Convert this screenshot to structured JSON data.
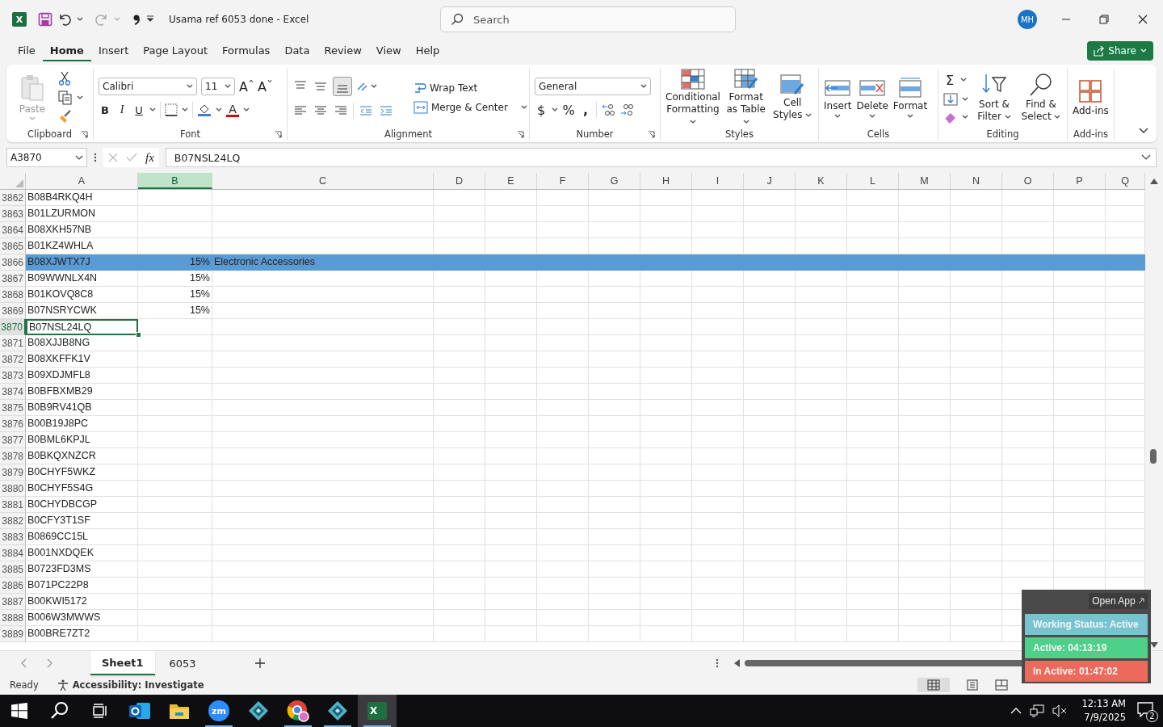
{
  "title_bar": {
    "app_letter": "X",
    "document_title": "Usama ref 6053 done  -  Excel",
    "search_placeholder": "Search",
    "avatar_initials": "MH"
  },
  "menu_tabs": [
    {
      "label": "File",
      "selected": false
    },
    {
      "label": "Home",
      "selected": true
    },
    {
      "label": "Insert",
      "selected": false
    },
    {
      "label": "Page Layout",
      "selected": false
    },
    {
      "label": "Formulas",
      "selected": false
    },
    {
      "label": "Data",
      "selected": false
    },
    {
      "label": "Review",
      "selected": false
    },
    {
      "label": "View",
      "selected": false
    },
    {
      "label": "Help",
      "selected": false
    }
  ],
  "share_button": "Share",
  "ribbon": {
    "clipboard": {
      "paste": "Paste",
      "label": "Clipboard"
    },
    "font": {
      "name": "Calibri",
      "size": "11",
      "grow": "A",
      "shrink": "A",
      "bold": "B",
      "italic": "I",
      "underline": "U",
      "color_letter": "A",
      "label": "Font"
    },
    "alignment": {
      "wrap_text": "Wrap Text",
      "merge": "Merge & Center",
      "label": "Alignment"
    },
    "number": {
      "format": "General",
      "currency": "$",
      "percent": "%",
      "comma": ",",
      "label": "Number"
    },
    "styles": {
      "buttons": [
        "Conditional Formatting",
        "Format as Table",
        "Cell Styles"
      ],
      "label": "Styles"
    },
    "cells": {
      "buttons": [
        "Insert",
        "Delete",
        "Format"
      ],
      "label": "Cells"
    },
    "editing": {
      "sum": "Σ",
      "buttons": [
        "Sort & Filter",
        "Find & Select"
      ],
      "label": "Editing"
    },
    "addins": {
      "button": "Add-ins",
      "label": "Add-ins"
    }
  },
  "formula_bar": {
    "name_box": "A3870",
    "fx": "fx",
    "formula": "B07NSL24LQ"
  },
  "columns": [
    {
      "label": "A",
      "selected": false
    },
    {
      "label": "B",
      "selected": true
    },
    {
      "label": "C",
      "selected": false
    },
    {
      "label": "D",
      "selected": false
    },
    {
      "label": "E",
      "selected": false
    },
    {
      "label": "F",
      "selected": false
    },
    {
      "label": "G",
      "selected": false
    },
    {
      "label": "H",
      "selected": false
    },
    {
      "label": "I",
      "selected": false
    },
    {
      "label": "J",
      "selected": false
    },
    {
      "label": "K",
      "selected": false
    },
    {
      "label": "L",
      "selected": false
    },
    {
      "label": "M",
      "selected": false
    },
    {
      "label": "N",
      "selected": false
    },
    {
      "label": "O",
      "selected": false
    },
    {
      "label": "P",
      "selected": false
    },
    {
      "label": "Q",
      "selected": false
    }
  ],
  "rows": [
    {
      "number": "3862",
      "cells": [
        "B08B4RKQ4H"
      ],
      "highlighted": false,
      "active": false
    },
    {
      "number": "3863",
      "cells": [
        "B01LZURMON"
      ],
      "highlighted": false,
      "active": false
    },
    {
      "number": "3864",
      "cells": [
        "B08XKH57NB"
      ],
      "highlighted": false,
      "active": false
    },
    {
      "number": "3865",
      "cells": [
        "B01KZ4WHLA"
      ],
      "highlighted": false,
      "active": false
    },
    {
      "number": "3866",
      "cells": [
        "B08XJWTX7J",
        "15%",
        "Electronic Accessories"
      ],
      "highlighted": true,
      "active": false
    },
    {
      "number": "3867",
      "cells": [
        "B09WWNLX4N",
        "15%"
      ],
      "highlighted": false,
      "active": false
    },
    {
      "number": "3868",
      "cells": [
        "B01KOVQ8C8",
        "15%"
      ],
      "highlighted": false,
      "active": false
    },
    {
      "number": "3869",
      "cells": [
        "B07NSRYCWK",
        "15%"
      ],
      "highlighted": false,
      "active": false
    },
    {
      "number": "3870",
      "cells": [
        "B07NSL24LQ"
      ],
      "highlighted": false,
      "active": true
    },
    {
      "number": "3871",
      "cells": [
        "B08XJJB8NG"
      ],
      "highlighted": false,
      "active": false
    },
    {
      "number": "3872",
      "cells": [
        "B08XKFFK1V"
      ],
      "highlighted": false,
      "active": false
    },
    {
      "number": "3873",
      "cells": [
        "B09XDJMFL8"
      ],
      "highlighted": false,
      "active": false
    },
    {
      "number": "3874",
      "cells": [
        "B0BFBXMB29"
      ],
      "highlighted": false,
      "active": false
    },
    {
      "number": "3875",
      "cells": [
        "B0B9RV41QB"
      ],
      "highlighted": false,
      "active": false
    },
    {
      "number": "3876",
      "cells": [
        "B00B19J8PC"
      ],
      "highlighted": false,
      "active": false
    },
    {
      "number": "3877",
      "cells": [
        "B0BML6KPJL"
      ],
      "highlighted": false,
      "active": false
    },
    {
      "number": "3878",
      "cells": [
        "B0BKQXNZCR"
      ],
      "highlighted": false,
      "active": false
    },
    {
      "number": "3879",
      "cells": [
        "B0CHYF5WKZ"
      ],
      "highlighted": false,
      "active": false
    },
    {
      "number": "3880",
      "cells": [
        "B0CHYF5S4G"
      ],
      "highlighted": false,
      "active": false
    },
    {
      "number": "3881",
      "cells": [
        "B0CHYDBCGP"
      ],
      "highlighted": false,
      "active": false
    },
    {
      "number": "3882",
      "cells": [
        "B0CFY3T1SF"
      ],
      "highlighted": false,
      "active": false
    },
    {
      "number": "3883",
      "cells": [
        "B0869CC15L"
      ],
      "highlighted": false,
      "active": false
    },
    {
      "number": "3884",
      "cells": [
        "B001NXDQEK"
      ],
      "highlighted": false,
      "active": false
    },
    {
      "number": "3885",
      "cells": [
        "B0723FD3MS"
      ],
      "highlighted": false,
      "active": false
    },
    {
      "number": "3886",
      "cells": [
        "B071PC22P8"
      ],
      "highlighted": false,
      "active": false
    },
    {
      "number": "3887",
      "cells": [
        "B00KWI5172"
      ],
      "highlighted": false,
      "active": false
    },
    {
      "number": "3888",
      "cells": [
        "B006W3MWWS"
      ],
      "highlighted": false,
      "active": false
    },
    {
      "number": "3889",
      "cells": [
        "B00BRE7ZT2"
      ],
      "highlighted": false,
      "active": false
    }
  ],
  "sheet_tabs": [
    {
      "label": "Sheet1",
      "selected": true
    },
    {
      "label": "6053",
      "selected": false
    }
  ],
  "status_bar": {
    "ready": "Ready",
    "accessibility": "Accessibility: Investigate"
  },
  "tracker": {
    "open_app": "Open App",
    "statuses": [
      {
        "text": "Working Status: Active",
        "color": "#77c4d0"
      },
      {
        "text": "Active: 04:13:19",
        "color": "#4fd08a"
      },
      {
        "text": "In Active: 01:47:02",
        "color": "#ec6a5c"
      }
    ]
  },
  "taskbar": {
    "apps": [
      {
        "kind": "mail",
        "running": false,
        "selected": false
      },
      {
        "kind": "folder",
        "running": false,
        "selected": false
      },
      {
        "kind": "meeting",
        "label": "zm",
        "running": true,
        "selected": false
      },
      {
        "kind": "diamond",
        "running": false,
        "selected": false
      },
      {
        "kind": "browser",
        "running": true,
        "selected": false
      },
      {
        "kind": "diamond",
        "running": true,
        "selected": false
      },
      {
        "kind": "sheet",
        "label": "X",
        "running": true,
        "selected": true
      }
    ],
    "time": "12:13 AM",
    "date": "7/9/2025",
    "notifications": "2"
  }
}
